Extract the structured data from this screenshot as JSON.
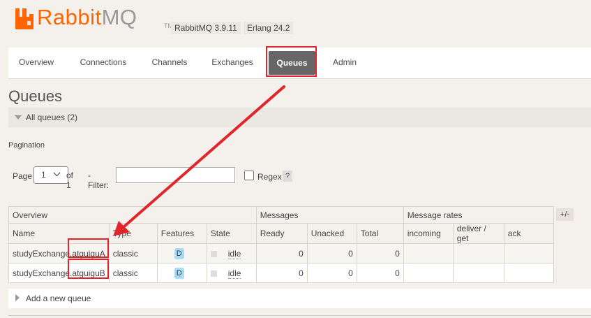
{
  "header": {
    "logo_primary": "Rabbit",
    "logo_secondary": "MQ",
    "logo_tm": "TM",
    "rabbitmq_version": "RabbitMQ 3.9.11",
    "erlang_version": "Erlang 24.2",
    "brand_color": "#ff6600"
  },
  "nav": {
    "tabs": [
      {
        "label": "Overview"
      },
      {
        "label": "Connections"
      },
      {
        "label": "Channels"
      },
      {
        "label": "Exchanges"
      },
      {
        "label": "Queues"
      },
      {
        "label": "Admin"
      }
    ],
    "active": "Queues"
  },
  "page": {
    "title": "Queues",
    "section_label": "All queues (2)",
    "pagination_label": "Pagination"
  },
  "filter": {
    "page_label": "Page",
    "page_value": "1",
    "of_label": "of 1",
    "filter_label": "- Filter:",
    "filter_value": "",
    "regex_label": "Regex",
    "help_label": "?"
  },
  "table": {
    "groups": [
      "Overview",
      "Messages",
      "Message rates"
    ],
    "toggle_label": "+/-",
    "columns": [
      "Name",
      "Type",
      "Features",
      "State",
      "Ready",
      "Unacked",
      "Total",
      "incoming",
      "deliver / get",
      "ack"
    ],
    "rows": [
      {
        "name": "studyExchange.atguiguA",
        "type": "classic",
        "feature": "D",
        "state": "idle",
        "ready": "0",
        "unacked": "0",
        "total": "0",
        "incoming": "",
        "deliver_get": "",
        "ack": ""
      },
      {
        "name": "studyExchange.atguiguB",
        "type": "classic",
        "feature": "D",
        "state": "idle",
        "ready": "0",
        "unacked": "0",
        "total": "0",
        "incoming": "",
        "deliver_get": "",
        "ack": ""
      }
    ]
  },
  "add_queue_label": "Add a new queue",
  "annotation_color": "#e0252c"
}
